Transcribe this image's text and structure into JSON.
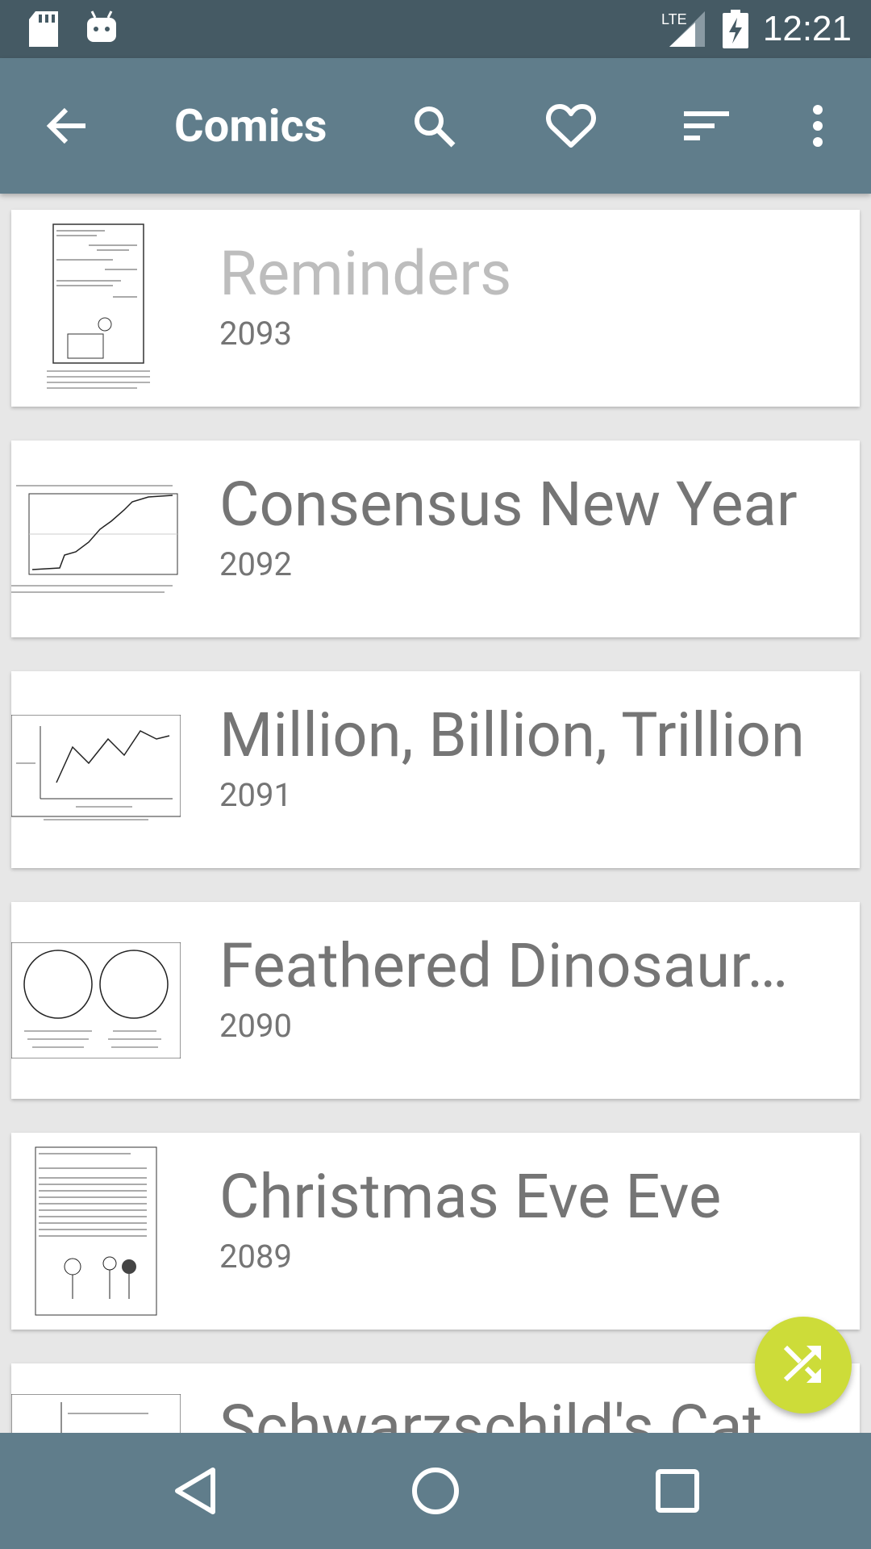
{
  "status_bar": {
    "time": "12:21",
    "network": "LTE",
    "icons": [
      "sd-card-icon",
      "android-debug-icon",
      "lte-signal-icon",
      "battery-charging-icon"
    ]
  },
  "app_bar": {
    "title": "Comics",
    "icons": [
      "back-arrow-icon",
      "search-icon",
      "heart-icon",
      "sort-icon",
      "overflow-menu-icon"
    ]
  },
  "comics": [
    {
      "title": "Reminders",
      "number": "2093",
      "read": true
    },
    {
      "title": "Consensus New Year",
      "number": "2092",
      "read": false
    },
    {
      "title": "Million, Billion, Trillion",
      "number": "2091",
      "read": false
    },
    {
      "title": "Feathered Dinosaur…",
      "number": "2090",
      "read": false
    },
    {
      "title": "Christmas Eve Eve",
      "number": "2089",
      "read": false
    },
    {
      "title": "Schwarzschild's Cat",
      "number": "",
      "read": false
    }
  ],
  "fab": {
    "icon": "shuffle-icon"
  },
  "nav_bar": {
    "icons": [
      "nav-back-icon",
      "nav-home-icon",
      "nav-recents-icon"
    ]
  },
  "colors": {
    "status_bar": "#455a64",
    "app_bar": "#607d8b",
    "background": "#e7e7e7",
    "fab": "#cddc39",
    "title_text": "#757575",
    "read_title_text": "#bdbdbd"
  }
}
